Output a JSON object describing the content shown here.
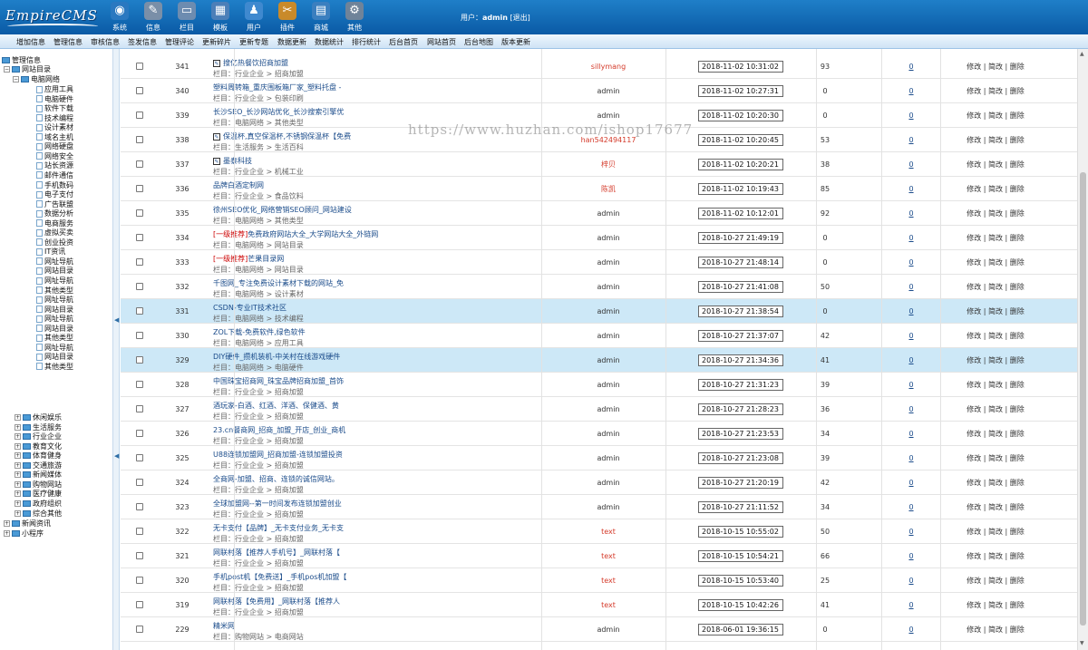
{
  "app": {
    "logo_text": "EmpireCMS"
  },
  "topnav": [
    {
      "label": "系统",
      "icon": "globe-icon"
    },
    {
      "label": "信息",
      "icon": "edit-icon"
    },
    {
      "label": "栏目",
      "icon": "folder-icon"
    },
    {
      "label": "模板",
      "icon": "template-icon"
    },
    {
      "label": "用户",
      "icon": "user-icon"
    },
    {
      "label": "插件",
      "icon": "plugin-icon"
    },
    {
      "label": "商城",
      "icon": "shop-icon"
    },
    {
      "label": "其他",
      "icon": "gear-icon"
    }
  ],
  "user": {
    "prefix": "用户：",
    "name": "admin",
    "logout": "[退出]"
  },
  "menubar": [
    "增加信息",
    "管理信息",
    "审核信息",
    "签发信息",
    "管理评论",
    "更新碎片",
    "更新专题",
    "数据更新",
    "数据统计",
    "排行统计",
    "后台首页",
    "网站首页",
    "后台地图",
    "版本更新"
  ],
  "sidebar": {
    "root": "管理信息",
    "site": "网站目录",
    "computer": "电脑网络",
    "sub": [
      "应用工具",
      "电脑硬件",
      "软件下载",
      "技术编程",
      "设计素材",
      "域名主机",
      "网络硬盘",
      "网络安全",
      "站长资源",
      "邮件通信",
      "手机数码",
      "电子支付",
      "广告联盟",
      "数据分析",
      "电商服务",
      "虚拟买卖",
      "创业投资",
      "IT资讯",
      "网址导航",
      "网站目录",
      "网址导航",
      "其他类型",
      "网址导航",
      "网站目录",
      "网址导航",
      "网站目录",
      "其他类型",
      "网址导航",
      "网站目录",
      "其他类型"
    ],
    "cats": [
      "休闲娱乐",
      "生活服务",
      "行业企业",
      "教育文化",
      "体育健身",
      "交通旅游",
      "新闻媒体",
      "购物网站",
      "医疗健康",
      "政府组织",
      "综合其他"
    ],
    "tail": [
      "新闻资讯",
      "小程序"
    ]
  },
  "watermark": "https://www.huzhan.com/ishop17677",
  "rows": [
    {
      "id": "341",
      "title": "搜亿热餐饮招商加盟",
      "cat": "栏目：行业企业 > 招商加盟",
      "author": "sillymang",
      "author_red": true,
      "date": "2018-11-02 10:31:02",
      "views": "93",
      "comments": "0",
      "icon": true
    },
    {
      "id": "340",
      "title": "塑料周转箱_重庆围板箱厂家_塑料托盘 -",
      "cat": "栏目：行业企业 > 包装印刷",
      "author": "admin",
      "author_red": false,
      "date": "2018-11-02 10:27:31",
      "views": "0",
      "comments": "0"
    },
    {
      "id": "339",
      "title": "长沙SEO_长沙网站优化_长沙搜索引擎优",
      "cat": "栏目：电脑网络 > 其他类型",
      "author": "admin",
      "author_red": false,
      "date": "2018-11-02 10:20:30",
      "views": "0",
      "comments": "0"
    },
    {
      "id": "338",
      "title": "保温杯,真空保温杯,不锈钢保温杯【免费",
      "cat": "栏目：生活服务 > 生活百科",
      "author": "han542494117",
      "author_red": true,
      "date": "2018-11-02 10:20:45",
      "views": "53",
      "comments": "0",
      "icon": true
    },
    {
      "id": "337",
      "title": "墨泰科技",
      "cat": "栏目：行业企业 > 机械工业",
      "author": "梓贝",
      "author_red": true,
      "date": "2018-11-02 10:20:21",
      "views": "38",
      "comments": "0",
      "icon": true
    },
    {
      "id": "336",
      "title": "品牌白酒定制网",
      "cat": "栏目：行业企业 > 食品饮料",
      "author": "陈凯",
      "author_red": true,
      "date": "2018-11-02 10:19:43",
      "views": "85",
      "comments": "0"
    },
    {
      "id": "335",
      "title": "徐州SEO优化_网络营销SEO顾问_网站建设",
      "cat": "栏目：电脑网络 > 其他类型",
      "author": "admin",
      "author_red": false,
      "date": "2018-11-02 10:12:01",
      "views": "92",
      "comments": "0"
    },
    {
      "id": "334",
      "tag": "[一级推荐]",
      "title": "免费政府网站大全_大学网站大全_外链网",
      "cat": "栏目：电脑网络 > 网站目录",
      "author": "admin",
      "author_red": false,
      "date": "2018-10-27 21:49:19",
      "views": "0",
      "comments": "0"
    },
    {
      "id": "333",
      "tag": "[一级推荐]",
      "title": "芒果目录网",
      "cat": "栏目：电脑网络 > 网站目录",
      "author": "admin",
      "author_red": false,
      "date": "2018-10-27 21:48:14",
      "views": "0",
      "comments": "0"
    },
    {
      "id": "332",
      "title": "千图网_专注免费设计素材下载的网站_免",
      "cat": "栏目：电脑网络 > 设计素材",
      "author": "admin",
      "author_red": false,
      "date": "2018-10-27 21:41:08",
      "views": "50",
      "comments": "0"
    },
    {
      "id": "331",
      "title": "CSDN-专业IT技术社区",
      "cat": "栏目：电脑网络 > 技术编程",
      "author": "admin",
      "author_red": false,
      "date": "2018-10-27 21:38:54",
      "views": "0",
      "comments": "0",
      "hl": true
    },
    {
      "id": "330",
      "title": "ZOL下载-免费软件,绿色软件",
      "cat": "栏目：电脑网络 > 应用工具",
      "author": "admin",
      "author_red": false,
      "date": "2018-10-27 21:37:07",
      "views": "42",
      "comments": "0"
    },
    {
      "id": "329",
      "title": "DIY硬件_攒机装机-中关村在线游戏硬件",
      "cat": "栏目：电脑网络 > 电脑硬件",
      "author": "admin",
      "author_red": false,
      "date": "2018-10-27 21:34:36",
      "views": "41",
      "comments": "0",
      "hl": true
    },
    {
      "id": "328",
      "title": "中国珠宝招商网_珠宝品牌招商加盟_首饰",
      "cat": "栏目：行业企业 > 招商加盟",
      "author": "admin",
      "author_red": false,
      "date": "2018-10-27 21:31:23",
      "views": "39",
      "comments": "0"
    },
    {
      "id": "327",
      "title": "酒玩家-白酒、红酒、洋酒、保健酒、黄",
      "cat": "栏目：行业企业 > 招商加盟",
      "author": "admin",
      "author_red": false,
      "date": "2018-10-27 21:28:23",
      "views": "36",
      "comments": "0"
    },
    {
      "id": "326",
      "title": "23.cn餐商网_招商_加盟_开店_创业_商机",
      "cat": "栏目：行业企业 > 招商加盟",
      "author": "admin",
      "author_red": false,
      "date": "2018-10-27 21:23:53",
      "views": "34",
      "comments": "0"
    },
    {
      "id": "325",
      "title": "U88连锁加盟网_招商加盟-连锁加盟投资",
      "cat": "栏目：行业企业 > 招商加盟",
      "author": "admin",
      "author_red": false,
      "date": "2018-10-27 21:23:08",
      "views": "39",
      "comments": "0"
    },
    {
      "id": "324",
      "title": "全商网-加盟、招商、连锁的诚信网站。",
      "cat": "栏目：行业企业 > 招商加盟",
      "author": "admin",
      "author_red": false,
      "date": "2018-10-27 21:20:19",
      "views": "42",
      "comments": "0"
    },
    {
      "id": "323",
      "title": "全球加盟网--第一时间发布连锁加盟创业",
      "cat": "栏目：行业企业 > 招商加盟",
      "author": "admin",
      "author_red": false,
      "date": "2018-10-27 21:11:52",
      "views": "34",
      "comments": "0"
    },
    {
      "id": "322",
      "title": "无卡支付【品牌】_无卡支付业务_无卡支",
      "cat": "栏目：行业企业 > 招商加盟",
      "author": "text",
      "author_red": true,
      "date": "2018-10-15 10:55:02",
      "views": "50",
      "comments": "0"
    },
    {
      "id": "321",
      "title": "网联村落【推荐人手机号】_网联村落【",
      "cat": "栏目：行业企业 > 招商加盟",
      "author": "text",
      "author_red": true,
      "date": "2018-10-15 10:54:21",
      "views": "66",
      "comments": "0"
    },
    {
      "id": "320",
      "title": "手机post机【免费送】_手机pos机加盟【",
      "cat": "栏目：行业企业 > 招商加盟",
      "author": "text",
      "author_red": true,
      "date": "2018-10-15 10:53:40",
      "views": "25",
      "comments": "0"
    },
    {
      "id": "319",
      "title": "网联村落【免费用】_网联村落【推荐人",
      "cat": "栏目：行业企业 > 招商加盟",
      "author": "text",
      "author_red": true,
      "date": "2018-10-15 10:42:26",
      "views": "41",
      "comments": "0"
    },
    {
      "id": "229",
      "title": "精米网",
      "cat": "栏目：购物网站 > 电商网站",
      "author": "admin",
      "author_red": false,
      "date": "2018-06-01 19:36:15",
      "views": "0",
      "comments": "0"
    }
  ],
  "ops": {
    "edit": "修改",
    "simple": "简改",
    "sep": "|",
    "delete": "删除"
  },
  "colors": {
    "accent": "#0a5aa5",
    "highlight": "#cde8f7",
    "author_red": "#d43a2a"
  }
}
